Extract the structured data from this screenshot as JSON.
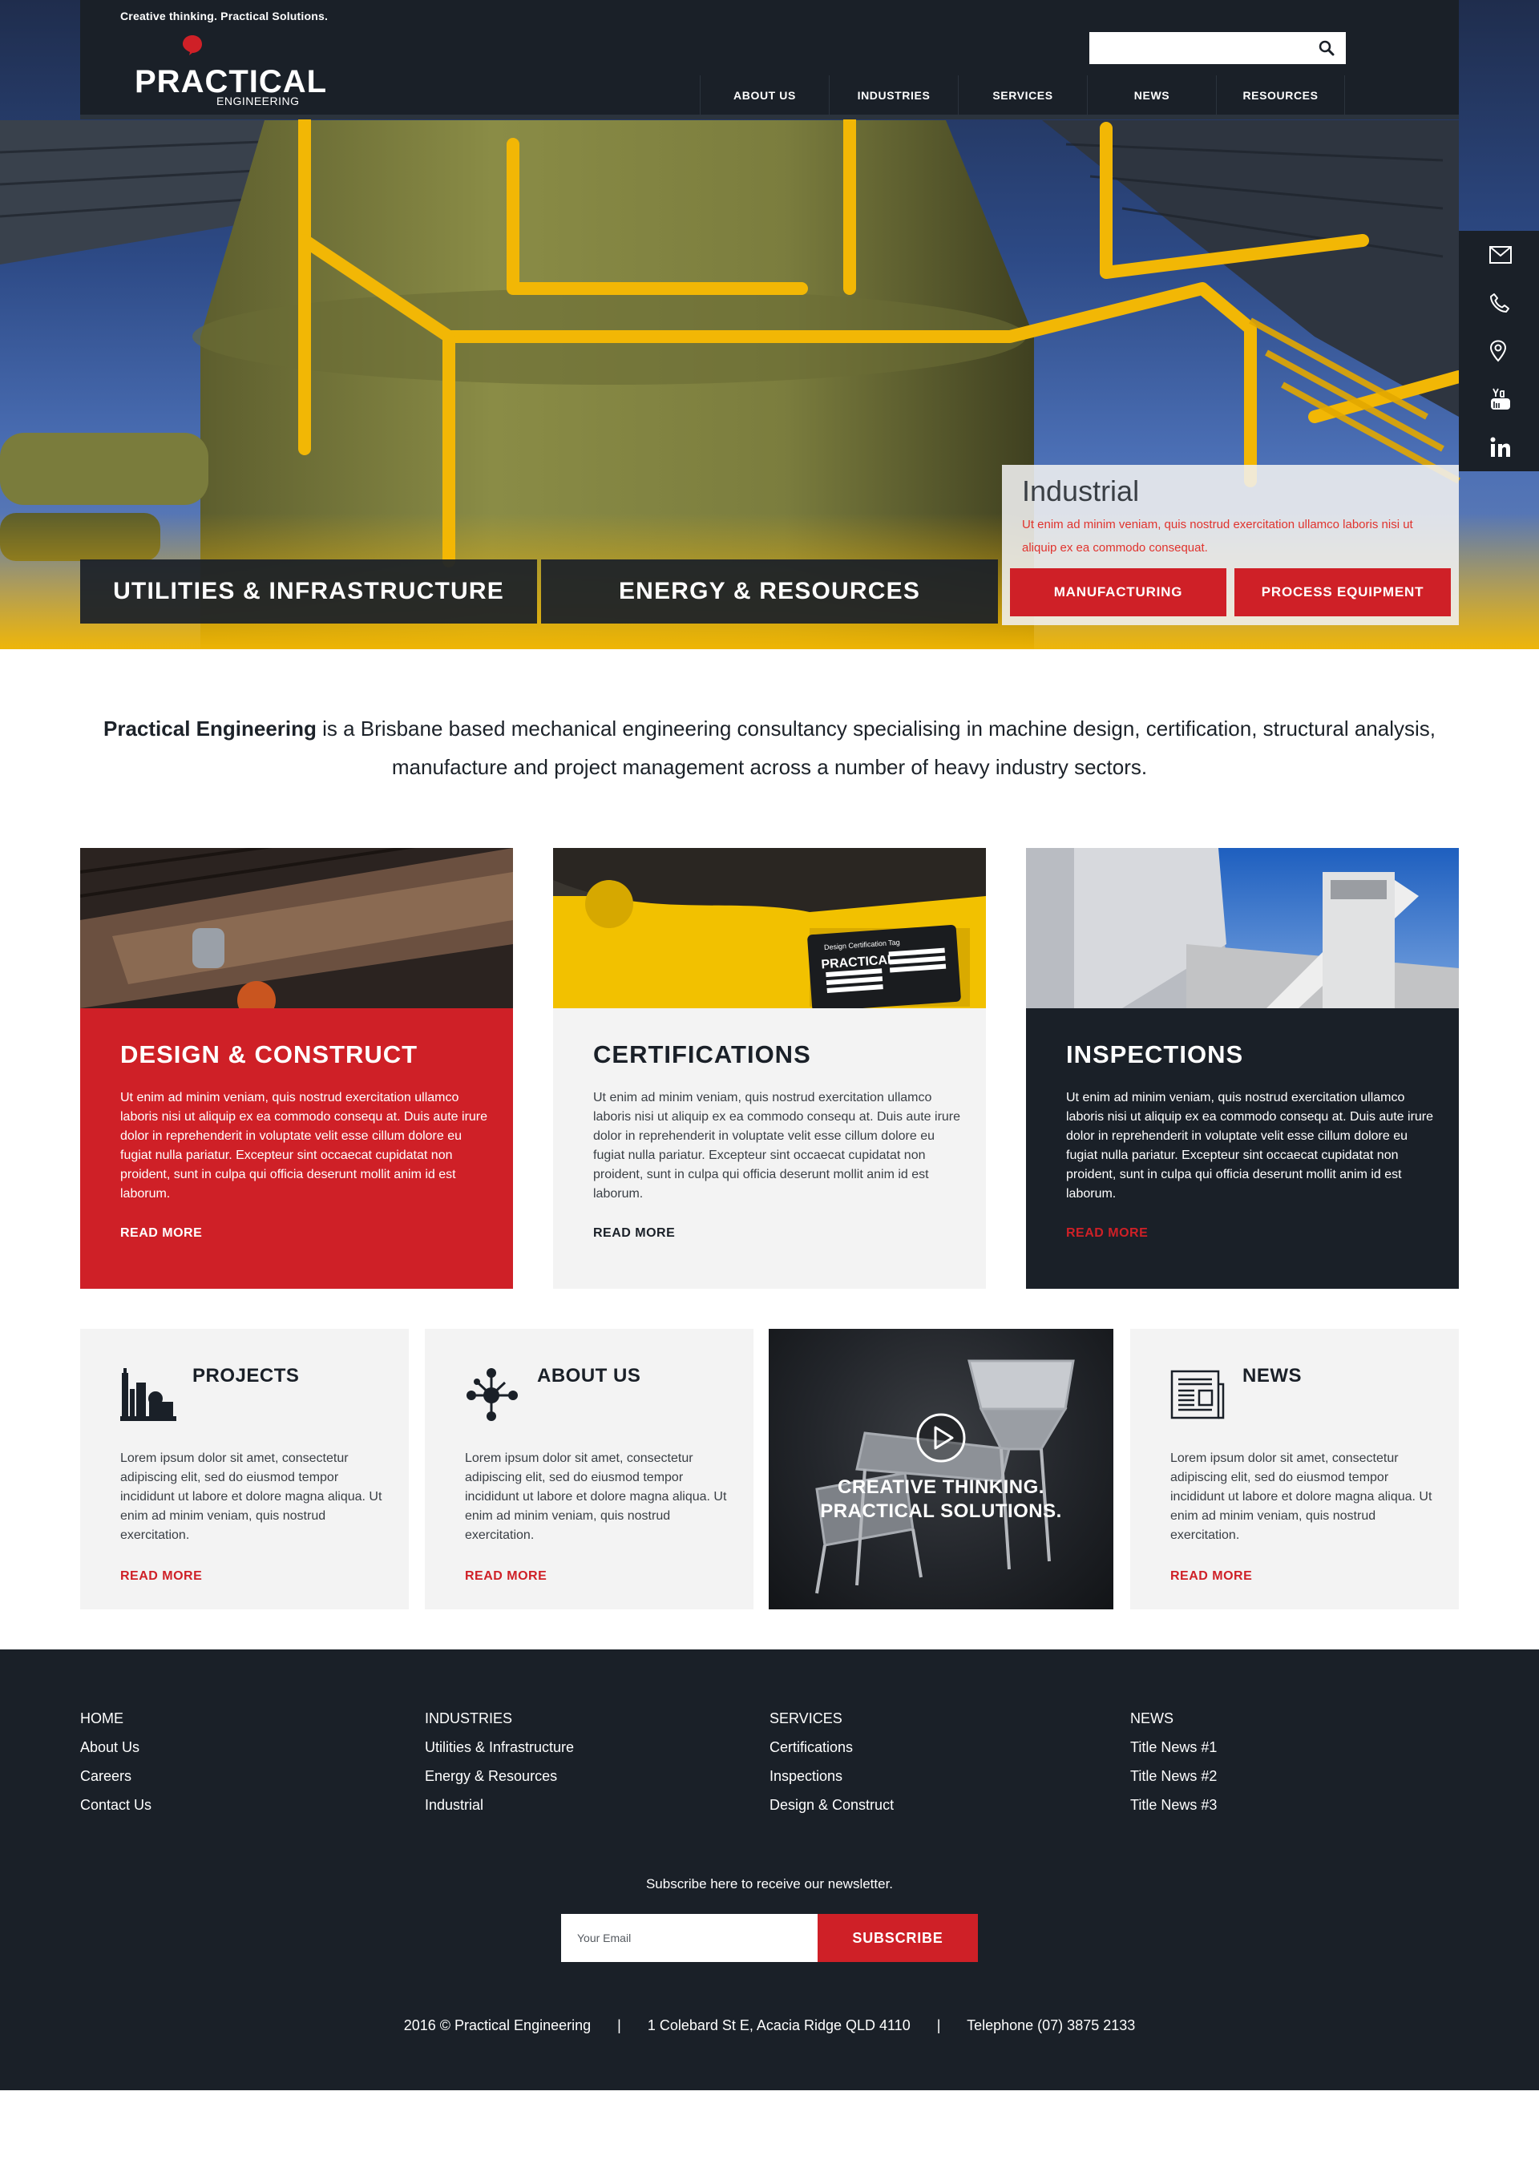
{
  "header": {
    "tagline": "Creative thinking. Practical Solutions.",
    "logo_main": "PRACTICAL",
    "logo_sub": "ENGINEERING",
    "search_placeholder": "",
    "nav": [
      "ABOUT US",
      "INDUSTRIES",
      "SERVICES",
      "NEWS",
      "RESOURCES"
    ]
  },
  "social": [
    "mail-icon",
    "phone-icon",
    "location-icon",
    "youtube-icon",
    "linkedin-icon"
  ],
  "hero": {
    "panel_title": "Industrial",
    "panel_text": "Ut enim ad minim veniam, quis nostrud exercitation ullamco laboris nisi ut aliquip ex ea commodo consequat.",
    "tabs": [
      "UTILITIES & INFRASTRUCTURE",
      "ENERGY & RESOURCES"
    ],
    "buttons": [
      "MANUFACTURING",
      "PROCESS EQUIPMENT"
    ]
  },
  "intro": {
    "company": "Practical Engineering",
    "text": " is a Brisbane based mechanical engineering consultancy specialising in machine design, certification, structural analysis, manufacture and project management across a number of heavy industry sectors."
  },
  "services": [
    {
      "title": "DESIGN & CONSTRUCT",
      "text": "Ut enim ad minim veniam, quis nostrud exercitation ullamco laboris nisi ut aliquip ex ea commodo consequ at. Duis aute irure dolor in reprehenderit in voluptate velit esse cillum dolore eu fugiat nulla pariatur. Excepteur sint occaecat cupidatat non proident, sunt in culpa qui officia deserunt mollit anim id est laborum.",
      "more": "READ MORE"
    },
    {
      "title": "CERTIFICATIONS",
      "text": "Ut enim ad minim veniam, quis nostrud exercitation ullamco laboris nisi ut aliquip ex ea commodo consequ at. Duis aute irure dolor in reprehenderit in voluptate velit esse cillum dolore eu fugiat nulla pariatur. Excepteur sint occaecat cupidatat non proident, sunt in culpa qui officia deserunt mollit anim id est laborum.",
      "more": "READ MORE",
      "plate_title": "Design Certification Tag",
      "plate_logo": "PRACTICAL"
    },
    {
      "title": "INSPECTIONS",
      "text": "Ut enim ad minim veniam, quis nostrud exercitation ullamco laboris nisi ut aliquip ex ea commodo consequ at. Duis aute irure dolor in reprehenderit in voluptate velit esse cillum dolore eu fugiat nulla pariatur. Excepteur sint occaecat cupidatat non proident, sunt in culpa qui officia deserunt mollit anim id est laborum.",
      "more": "READ MORE"
    }
  ],
  "features": [
    {
      "title": "PROJECTS",
      "text": "Lorem ipsum dolor sit amet, consectetur adipiscing elit, sed do eiusmod tempor incididunt ut labore et dolore magna aliqua. Ut enim ad minim veniam, quis nostrud exercitation.",
      "more": "READ MORE",
      "icon": "factory-icon"
    },
    {
      "title": "ABOUT US",
      "text": "Lorem ipsum dolor sit amet, consectetur adipiscing elit, sed do eiusmod tempor incididunt ut labore et dolore magna aliqua. Ut enim ad minim veniam, quis nostrud exercitation.",
      "more": "READ MORE",
      "icon": "network-icon"
    },
    {
      "title": "NEWS",
      "text": "Lorem ipsum dolor sit amet, consectetur adipiscing elit, sed do eiusmod tempor incididunt ut labore et dolore magna aliqua. Ut enim ad minim veniam, quis nostrud exercitation.",
      "more": "READ MORE",
      "icon": "newspaper-icon"
    }
  ],
  "video": {
    "line1": "CREATIVE THINKING.",
    "line2": "PRACTICAL SOLUTIONS."
  },
  "footer": {
    "columns": [
      {
        "head": "HOME",
        "links": [
          "About Us",
          "Careers",
          "Contact Us"
        ]
      },
      {
        "head": "INDUSTRIES",
        "links": [
          "Utilities & Infrastructure",
          "Energy & Resources",
          "Industrial"
        ]
      },
      {
        "head": "SERVICES",
        "links": [
          "Certifications",
          "Inspections",
          "Design & Construct"
        ]
      },
      {
        "head": "NEWS",
        "links": [
          "Title News #1",
          "Title News #2",
          "Title News #3"
        ]
      }
    ],
    "subscribe_label": "Subscribe here to receive our newsletter.",
    "email_placeholder": "Your Email",
    "subscribe_button": "SUBSCRIBE",
    "copyright": "2016 © Practical Engineering",
    "address": "1 Colebard St E, Acacia Ridge QLD 4110",
    "telephone": "Telephone (07) 3875 2133",
    "separator": "|"
  },
  "colors": {
    "brand_red": "#cf2027",
    "dark_navy": "#1a2028",
    "light_grey": "#f3f3f3",
    "accent_yellow": "#f5b800"
  }
}
